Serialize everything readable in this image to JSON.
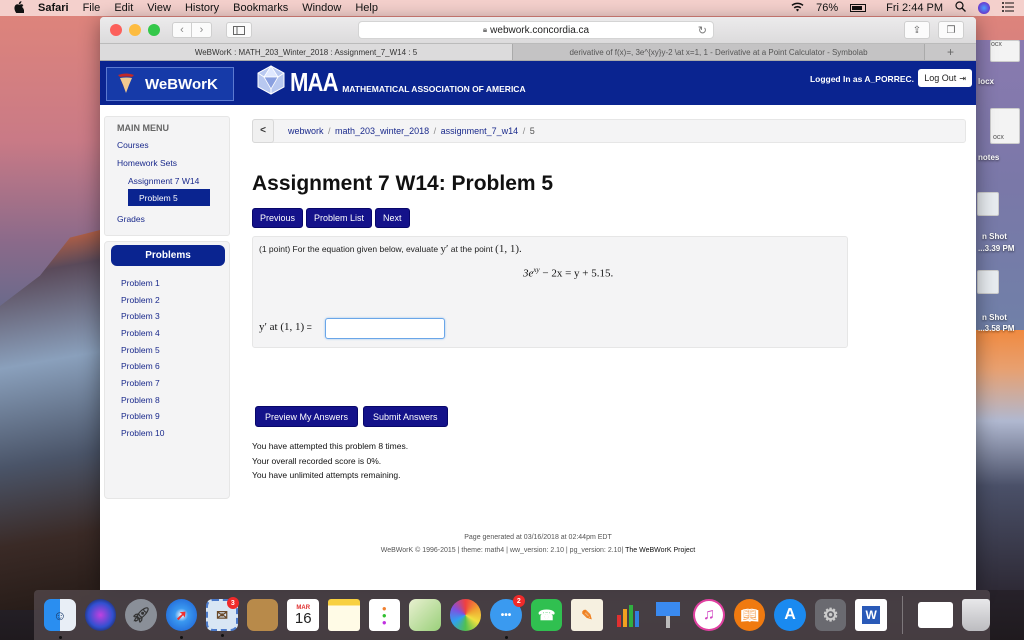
{
  "menubar": {
    "app": "Safari",
    "items": [
      "File",
      "Edit",
      "View",
      "History",
      "Bookmarks",
      "Window",
      "Help"
    ],
    "battery": "76%",
    "clock": "Fri 2:44 PM",
    "icons": [
      "apple-icon",
      "wifi-icon",
      "battery-icon",
      "spotlight-icon",
      "siri-icon",
      "notification-center-icon"
    ]
  },
  "browser": {
    "url": "webwork.concordia.ca",
    "tabs": [
      {
        "label": "WeBWorK : MATH_203_Winter_2018 : Assignment_7_W14 : 5",
        "active": true
      },
      {
        "label": "derivative of f(x)=, 3e^{xy}y-2 \\at x=1, 1 - Derivative at a Point Calculator - Symbolab",
        "active": false
      }
    ],
    "new_tab": "+"
  },
  "header": {
    "logo_text": "WeBWorK",
    "maa_big": "MAA",
    "maa_sub": "MATHEMATICAL ASSOCIATION OF AMERICA",
    "logged_in": "Logged In as A_PORREC.",
    "logout": "Log Out"
  },
  "main_menu": {
    "title": "MAIN MENU",
    "courses": "Courses",
    "homework_sets": "Homework Sets",
    "assignment": "Assignment 7 W14",
    "active_problem": "Problem 5",
    "grades": "Grades"
  },
  "problems_panel": {
    "title": "Problems",
    "items": [
      "Problem 1",
      "Problem 2",
      "Problem 3",
      "Problem 4",
      "Problem 5",
      "Problem 6",
      "Problem 7",
      "Problem 8",
      "Problem 9",
      "Problem 10"
    ]
  },
  "breadcrumb": {
    "back": "<",
    "parts": [
      "webwork",
      "math_203_winter_2018",
      "assignment_7_w14",
      "5"
    ]
  },
  "page_title": "Assignment 7 W14: Problem 5",
  "nav_buttons": {
    "previous": "Previous",
    "problem_list": "Problem List",
    "next": "Next"
  },
  "problem": {
    "intro": "(1 point) For the equation given below, evaluate ",
    "yprime": "y′",
    "mid": " at the point ",
    "point": "(1, 1).",
    "eq_coef": "3e",
    "eq_exp": "xy",
    "eq_rest": " − 2x = y + 5.15.",
    "answer_label": "y′ at (1, 1)",
    "answer_eq": " =",
    "answer_value": ""
  },
  "submit": {
    "preview": "Preview My Answers",
    "submit": "Submit Answers"
  },
  "status": {
    "attempts": "You have attempted this problem 8 times.",
    "score": "Your overall recorded score is 0%.",
    "remaining": "You have unlimited attempts remaining."
  },
  "footer": {
    "generated": "Page generated at 03/16/2018 at 02:44pm EDT",
    "copyright": "WeBWorK © 1996-2015 | theme: math4 | ww_version: 2.10 | pg_version: 2.10|",
    "project": " The WeBWorK Project"
  },
  "desktop": {
    "labels": [
      "locx",
      "notes",
      "n Shot",
      "...3.39 PM",
      "n Shot",
      "...3.58 PM"
    ],
    "file_ext": "ocx"
  },
  "dock": {
    "apps": [
      {
        "name": "finder",
        "running": true
      },
      {
        "name": "siri",
        "running": false
      },
      {
        "name": "launchpad",
        "running": false
      },
      {
        "name": "safari",
        "running": true
      },
      {
        "name": "mail",
        "running": true,
        "badge": "3"
      },
      {
        "name": "contacts",
        "running": false
      },
      {
        "name": "calendar",
        "running": false,
        "month": "MAR",
        "day": "16"
      },
      {
        "name": "notes",
        "running": false
      },
      {
        "name": "reminders",
        "running": false
      },
      {
        "name": "maps",
        "running": false
      },
      {
        "name": "photos",
        "running": false
      },
      {
        "name": "messages",
        "running": true,
        "badge": "2"
      },
      {
        "name": "facetime",
        "running": false
      },
      {
        "name": "pages",
        "running": false
      },
      {
        "name": "numbers",
        "running": false
      },
      {
        "name": "keynote",
        "running": false
      },
      {
        "name": "itunes",
        "running": false
      },
      {
        "name": "ibooks",
        "running": false
      },
      {
        "name": "app-store",
        "running": false
      },
      {
        "name": "system-preferences",
        "running": false
      },
      {
        "name": "microsoft-word",
        "running": false,
        "letter": "W"
      },
      {
        "name": "downloads-stack",
        "running": false
      },
      {
        "name": "trash",
        "running": false
      }
    ]
  }
}
